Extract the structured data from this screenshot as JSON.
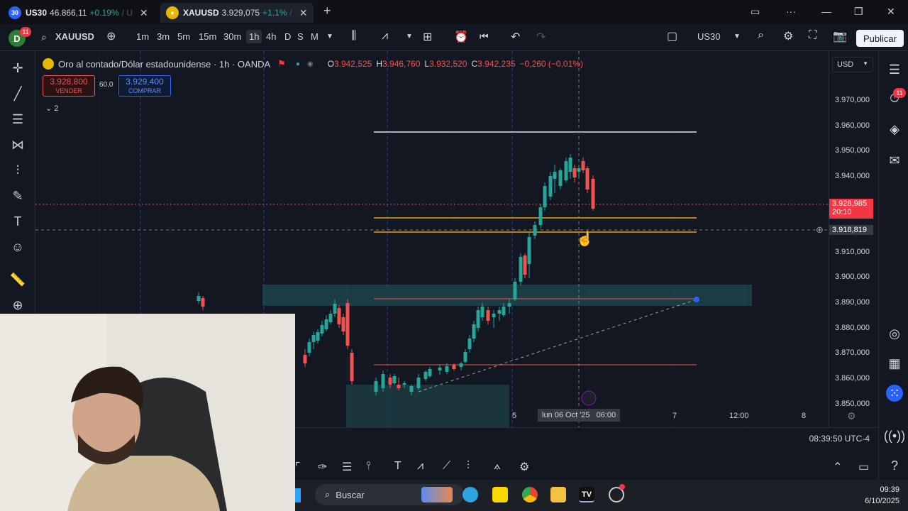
{
  "tabs": [
    {
      "badge": "30",
      "symbol": "US30",
      "price": "46.866,11",
      "change": "+0.19%",
      "tail": "/ U",
      "badge_color": "#2962ff"
    },
    {
      "badge": "",
      "symbol": "XAUUSD",
      "price": "3.929,075",
      "change": "+1.1%",
      "tail": "/",
      "badge_color": "#e6b800"
    }
  ],
  "toolbar": {
    "avatar": "D",
    "avatar_badge": "11",
    "symbol": "XAUUSD",
    "intervals": [
      "1m",
      "3m",
      "5m",
      "15m",
      "30m",
      "1h",
      "4h",
      "D",
      "S",
      "M"
    ],
    "selected_interval": "1h",
    "layout_name": "US30",
    "publish_label": "Publicar"
  },
  "legend": {
    "title": "Oro al contado/Dólar estadounidense · 1h · OANDA",
    "o_label": "O",
    "o": "3.942,525",
    "h_label": "H",
    "h": "3.946,760",
    "l_label": "L",
    "l": "3.932,520",
    "c_label": "C",
    "c": "3.942,235",
    "change": "−0,260 (−0,01%)",
    "indicators_count": "2"
  },
  "trade": {
    "sell_price": "3.928,800",
    "sell_label": "VENDER",
    "spread": "60,0",
    "buy_price": "3.929,400",
    "buy_label": "COMPRAR"
  },
  "price_axis": {
    "currency": "USD",
    "ticks": [
      "3.970,000",
      "3.960,000",
      "3.950,000",
      "3.940,000",
      "3.910,000",
      "3.900,000",
      "3.890,000",
      "3.880,000",
      "3.870,000",
      "3.860,000",
      "3.850,000"
    ],
    "current_price": "3.928,985",
    "countdown": "20:10",
    "crosshair_price": "3.918,819"
  },
  "time_axis": {
    "ticks": [
      "5",
      "7",
      "12:00",
      "8"
    ],
    "crosshair_label": "lun 06 Oct '25",
    "crosshair_time": "06:00"
  },
  "clock": "08:39:50 UTC-4",
  "right_badge": "11",
  "taskbar": {
    "search_placeholder": "Buscar",
    "time": "09:39",
    "date": "6/10/2025"
  },
  "colors": {
    "background": "#131722",
    "bull": "#26a69a",
    "bear": "#ef5350",
    "zone": "#1f4a4f",
    "orange_line": "#f0a30a"
  }
}
